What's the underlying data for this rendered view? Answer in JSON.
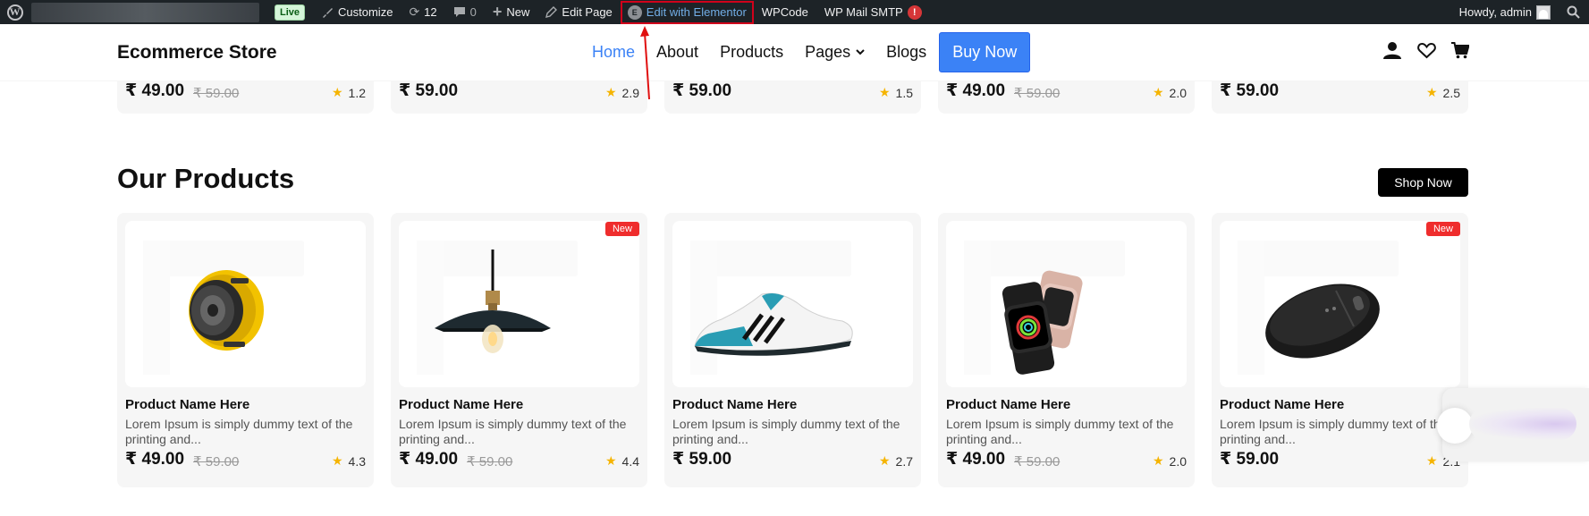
{
  "adminbar": {
    "live": "Live",
    "customize": "Customize",
    "updates": "12",
    "comments": "0",
    "new": "New",
    "edit_page": "Edit Page",
    "edit_elementor": "Edit with Elementor",
    "wpcode": "WPCode",
    "wp_mail_smtp": "WP Mail SMTP",
    "smtp_alert": "!",
    "howdy": "Howdy, admin",
    "wp_logo": "W",
    "elementor_logo": "E"
  },
  "header": {
    "logo": "Ecommerce Store",
    "nav": {
      "home": "Home",
      "about": "About",
      "products": "Products",
      "pages": "Pages",
      "blogs": "Blogs",
      "buy_now": "Buy Now"
    },
    "accent_color": "#3b82f6"
  },
  "top_row": [
    {
      "price": "₹ 49.00",
      "old_price": "₹ 59.00",
      "rating": "1.2"
    },
    {
      "price": "₹ 59.00",
      "old_price": "",
      "rating": "2.9"
    },
    {
      "price": "₹ 59.00",
      "old_price": "",
      "rating": "1.5"
    },
    {
      "price": "₹ 49.00",
      "old_price": "₹ 59.00",
      "rating": "2.0"
    },
    {
      "price": "₹ 59.00",
      "old_price": "",
      "rating": "2.5"
    }
  ],
  "products_section": {
    "title": "Our Products",
    "shop_now": "Shop Now",
    "items": [
      {
        "badge": "",
        "image": "yellow-speaker",
        "name": "Product Name Here",
        "desc": "Lorem Ipsum is simply dummy text of the printing and...",
        "price": "₹ 49.00",
        "old_price": "₹ 59.00",
        "rating": "4.3"
      },
      {
        "badge": "New",
        "image": "pendant-lamp",
        "name": "Product Name Here",
        "desc": "Lorem Ipsum is simply dummy text of the printing and...",
        "price": "₹ 49.00",
        "old_price": "₹ 59.00",
        "rating": "4.4"
      },
      {
        "badge": "",
        "image": "sneaker",
        "name": "Product Name Here",
        "desc": "Lorem Ipsum is simply dummy text of the printing and...",
        "price": "₹ 59.00",
        "old_price": "",
        "rating": "2.7"
      },
      {
        "badge": "",
        "image": "smartwatches",
        "name": "Product Name Here",
        "desc": "Lorem Ipsum is simply dummy text of the printing and...",
        "price": "₹ 49.00",
        "old_price": "₹ 59.00",
        "rating": "2.0"
      },
      {
        "badge": "New",
        "image": "computer-mouse",
        "name": "Product Name Here",
        "desc": "Lorem Ipsum is simply dummy text of the printing and...",
        "price": "₹ 59.00",
        "old_price": "",
        "rating": "2.1"
      }
    ]
  }
}
